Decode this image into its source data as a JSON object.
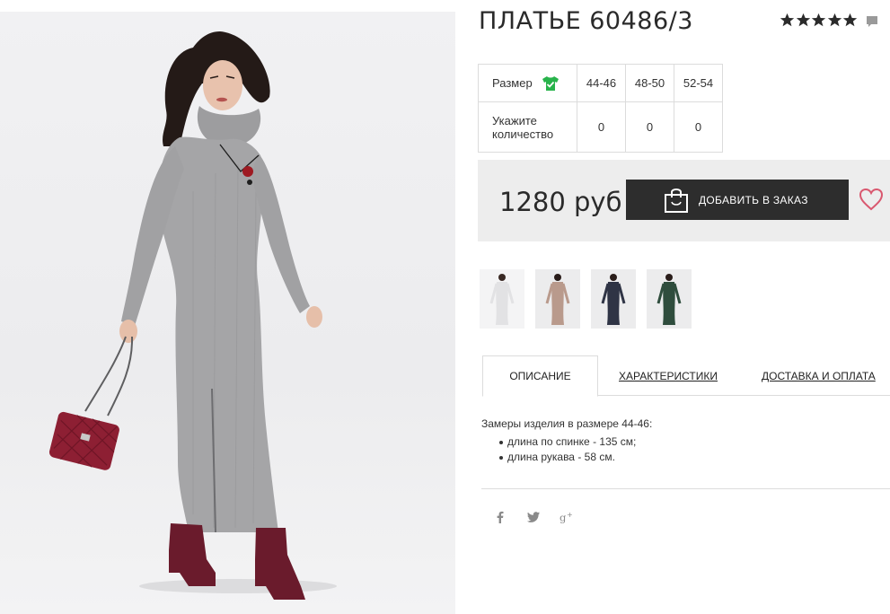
{
  "product": {
    "title": "ПЛАТЬЕ 60486/3",
    "rating_stars": 5,
    "price": "1280 руб",
    "add_to_order": "ДОБАВИТЬ В ЗАКАЗ"
  },
  "size_table": {
    "size_label": "Размер",
    "qty_label": "Укажите количество",
    "sizes": [
      "44-46",
      "48-50",
      "52-54"
    ],
    "quantities": [
      "0",
      "0",
      "0"
    ]
  },
  "thumbnails": [
    {
      "name": "thumb-white-dress",
      "color": "#e9e9eb"
    },
    {
      "name": "thumb-beige-dress",
      "color": "#b99a8c"
    },
    {
      "name": "thumb-navy-dress",
      "color": "#2f3445"
    },
    {
      "name": "thumb-green-dress",
      "color": "#2f4d3d"
    }
  ],
  "tabs": {
    "description": "ОПИСАНИЕ",
    "characteristics": "ХАРАКТЕРИСТИКИ",
    "delivery": "ДОСТАВКА И ОПЛАТА"
  },
  "description": {
    "intro": "Замеры изделия в размере 44-46:",
    "items": [
      "длина по спинке - 135 см;",
      "длина рукава - 58 см."
    ]
  },
  "icons": {
    "rating": "star-icon",
    "comments": "comment-icon",
    "size_guide": "shirt-check-icon",
    "bag": "shopping-bag-icon",
    "wishlist": "heart-icon",
    "social": [
      "facebook-icon",
      "twitter-icon",
      "google-plus-icon"
    ]
  },
  "colors": {
    "button_bg": "#2d2d2d",
    "buy_bar_bg": "#ededed",
    "size_icon": "#28b34b",
    "heart": "#d9586f",
    "dress": "#a3a3a5",
    "bag": "#8d1f33"
  }
}
